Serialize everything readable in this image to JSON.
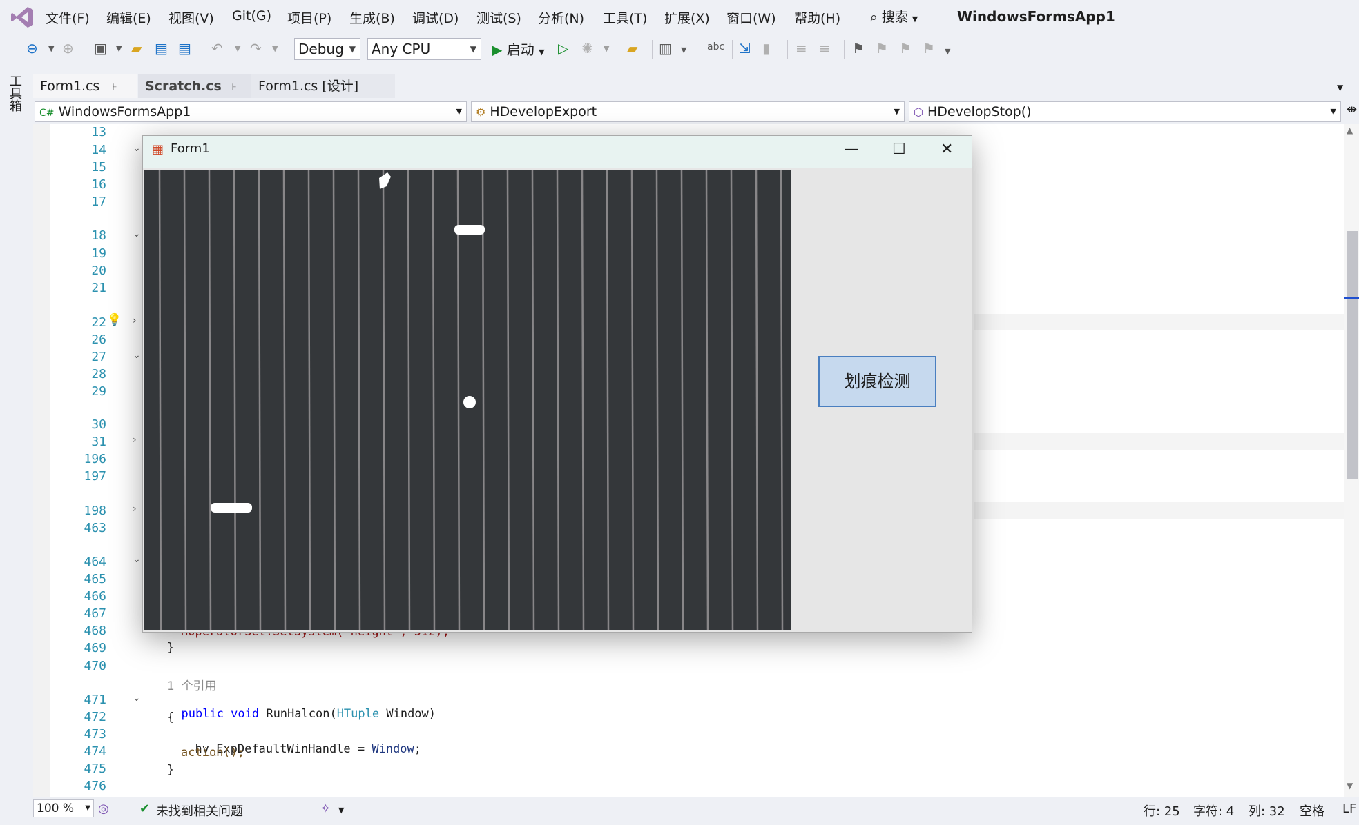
{
  "menu": {
    "items": [
      "文件(F)",
      "编辑(E)",
      "视图(V)",
      "Git(G)",
      "项目(P)",
      "生成(B)",
      "调试(D)",
      "测试(S)",
      "分析(N)",
      "工具(T)",
      "扩展(X)",
      "窗口(W)",
      "帮助(H)"
    ],
    "search": "搜索",
    "solution_title": "WindowsFormsApp1"
  },
  "toolbar": {
    "config": "Debug",
    "platform": "Any CPU",
    "start_label": "启动"
  },
  "toolbox_label": "工具箱",
  "tabs": [
    {
      "label": "Form1.cs"
    },
    {
      "label": "Scratch.cs"
    },
    {
      "label": "Form1.cs [设计]"
    }
  ],
  "navbar": {
    "project": "WindowsFormsApp1",
    "class": "HDevelopExport",
    "member": "HDevelopStop()"
  },
  "editor": {
    "line_numbers": [
      "13",
      "14",
      "15",
      "16",
      "17",
      "18",
      "19",
      "20",
      "21",
      "22",
      "26",
      "27",
      "28",
      "29",
      "30",
      "31",
      "196",
      "197",
      "198",
      "463",
      "464",
      "465",
      "466",
      "467",
      "468",
      "469",
      "470",
      "471",
      "472",
      "473",
      "474",
      "475",
      "476"
    ],
    "code": {
      "l468": "HOperatorSet.SetSystem(\"height\", 512);",
      "l469": "}",
      "ref_count": "1 个引用",
      "l471_kw": "public void",
      "l471_name": "RunHalcon(",
      "l471_type": "HTuple",
      "l471_param": "Window)",
      "l472": "{",
      "l473_a": "hv_ExpDefaultWinHandle = ",
      "l473_b": "Window",
      "l473_c": ";",
      "l474": "action();",
      "l475": "}"
    }
  },
  "form1": {
    "title": "Form1",
    "button_label": "划痕检测"
  },
  "statusbar": {
    "zoom": "100 %",
    "issues": "未找到相关问题",
    "line": "行: 25",
    "char": "字符: 4",
    "col": "列: 32",
    "space": "空格",
    "eol": "LF"
  }
}
